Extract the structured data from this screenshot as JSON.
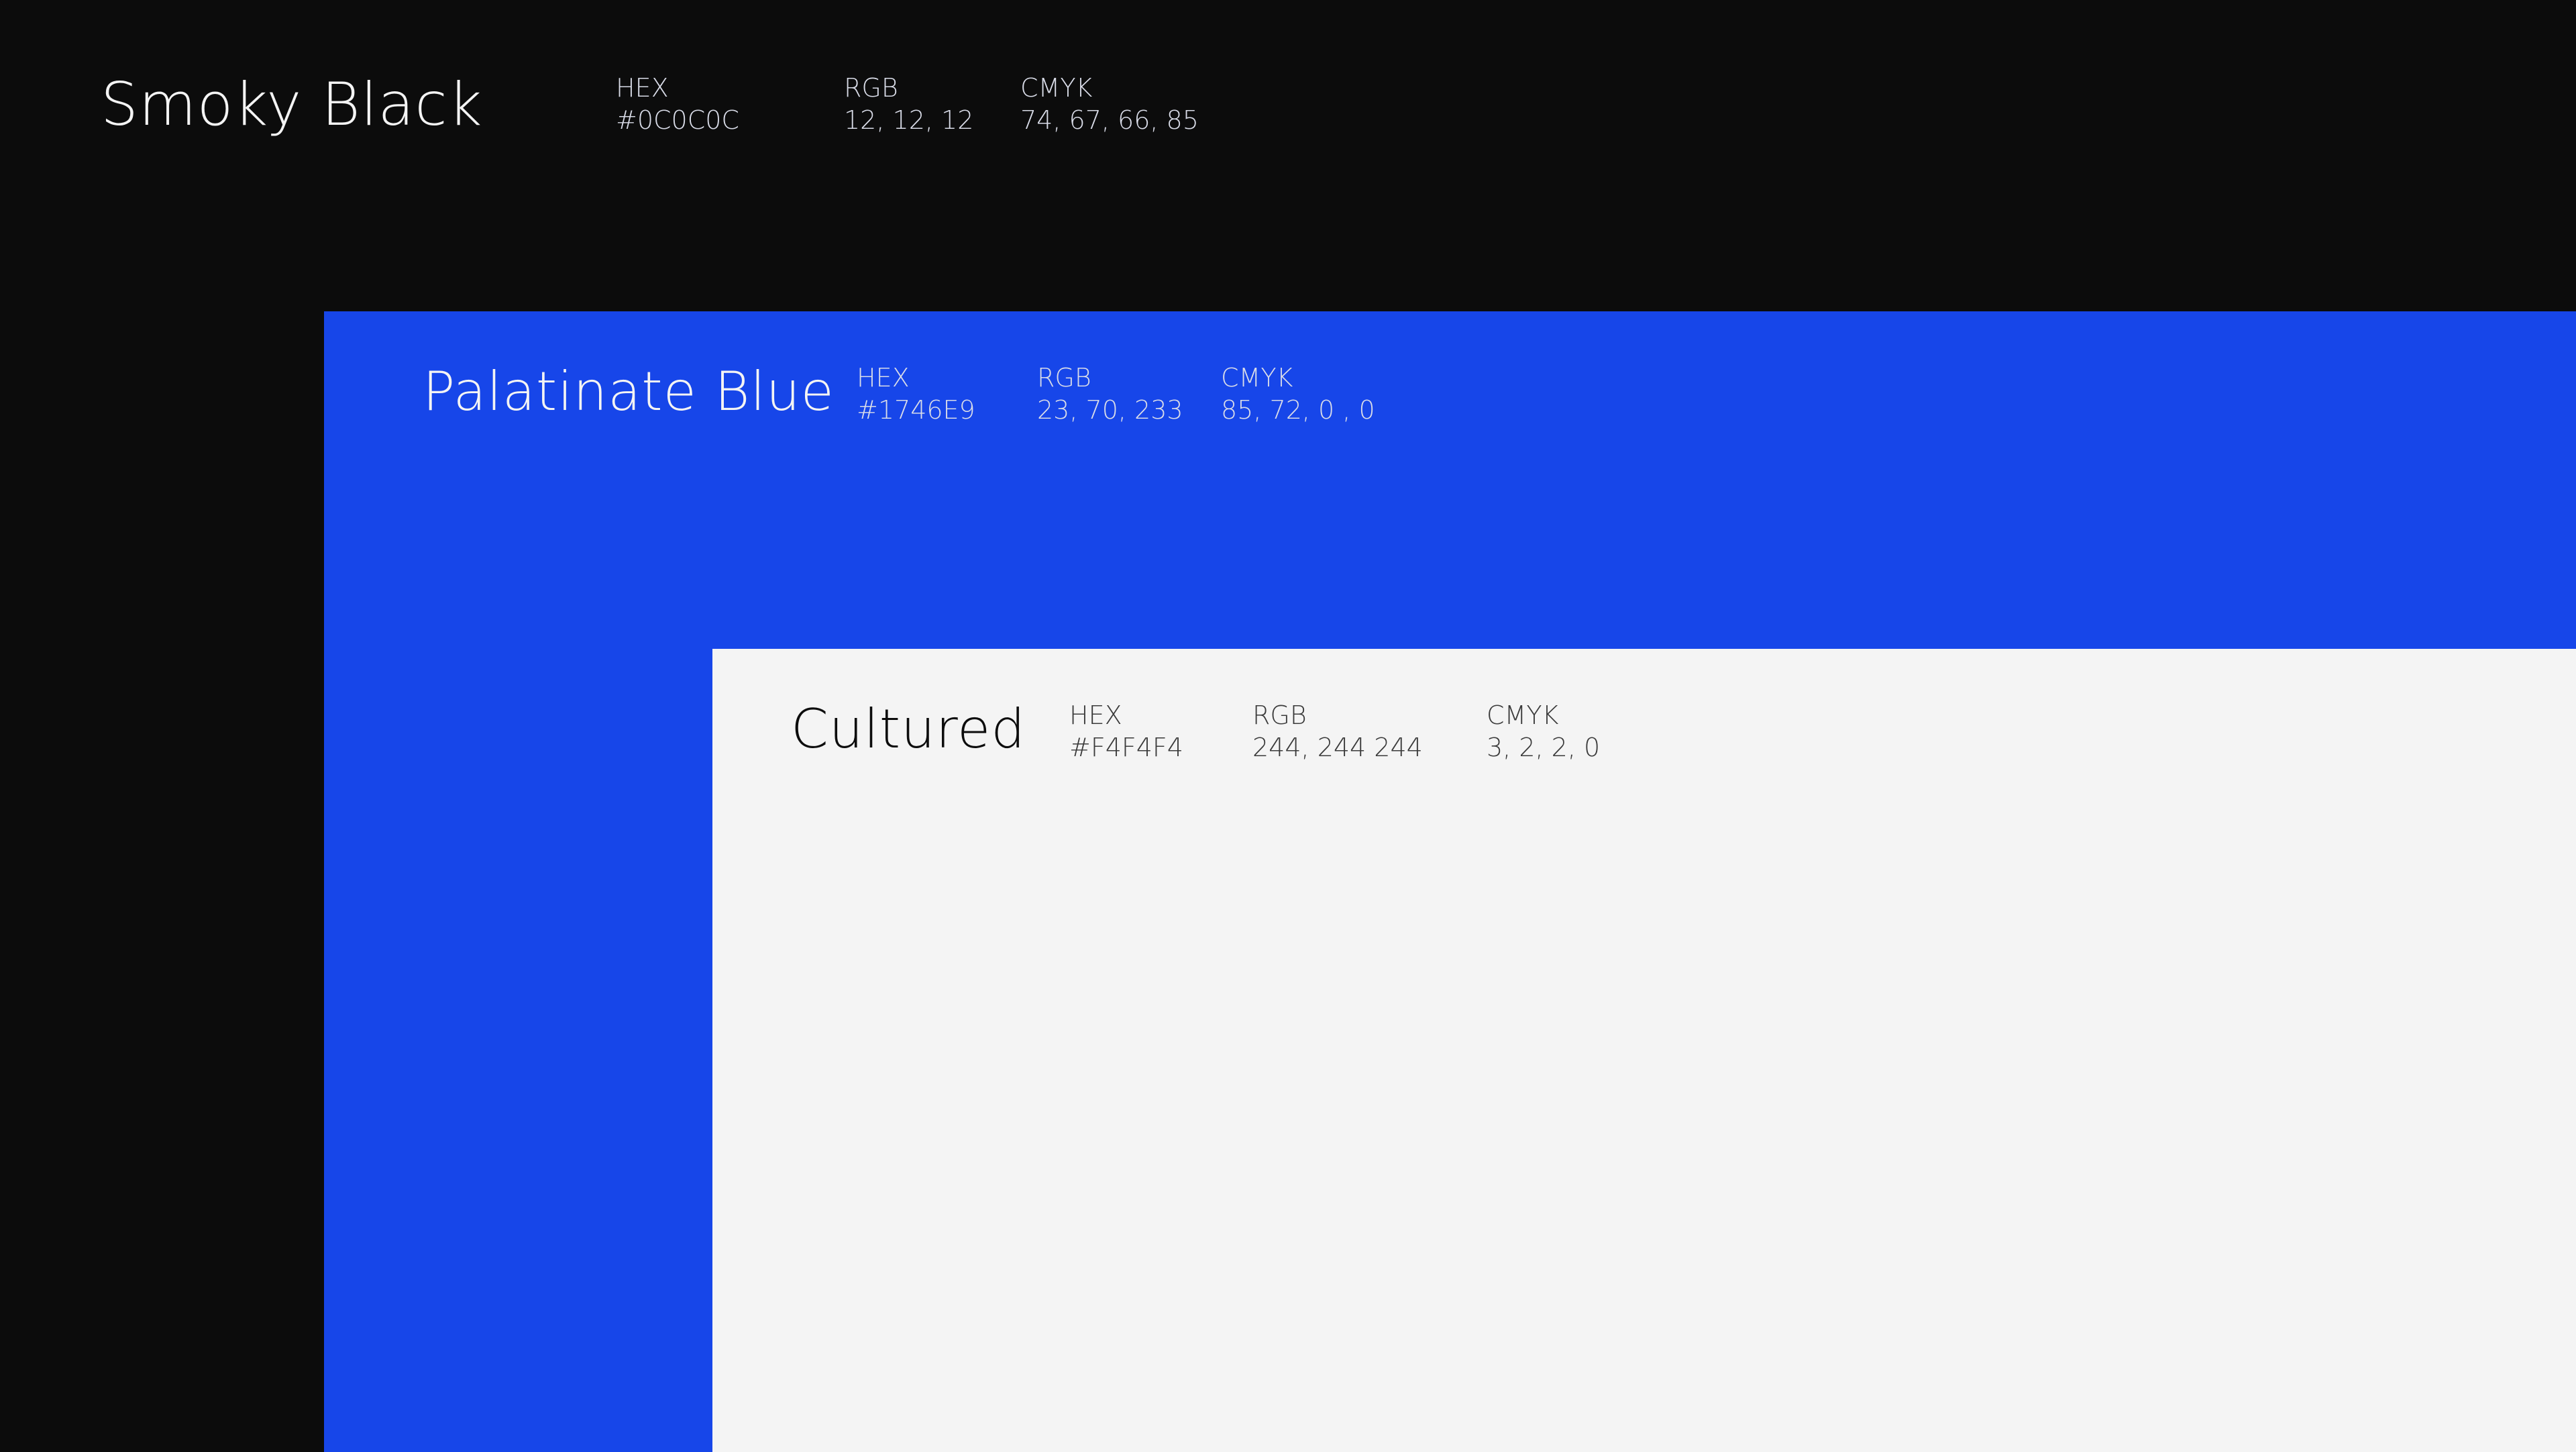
{
  "swatches": [
    {
      "name": "Smoky Black",
      "hex_label": "HEX",
      "hex": "#0C0C0C",
      "rgb_label": "RGB",
      "rgb": "12, 12, 12",
      "cmyk_label": "CMYK",
      "cmyk": "74, 67, 66, 85",
      "color": "#0C0C0C"
    },
    {
      "name": "Palatinate Blue",
      "hex_label": "HEX",
      "hex": "#1746E9",
      "rgb_label": "RGB",
      "rgb": "23, 70, 233",
      "cmyk_label": "CMYK",
      "cmyk": "85, 72, 0 , 0",
      "color": "#1746E9"
    },
    {
      "name": "Cultured",
      "hex_label": "HEX",
      "hex": "#F4F4F4",
      "rgb_label": "RGB",
      "rgb": "244, 244 244",
      "cmyk_label": "CMYK",
      "cmyk": "3, 2, 2,  0",
      "color": "#F4F4F4"
    }
  ]
}
